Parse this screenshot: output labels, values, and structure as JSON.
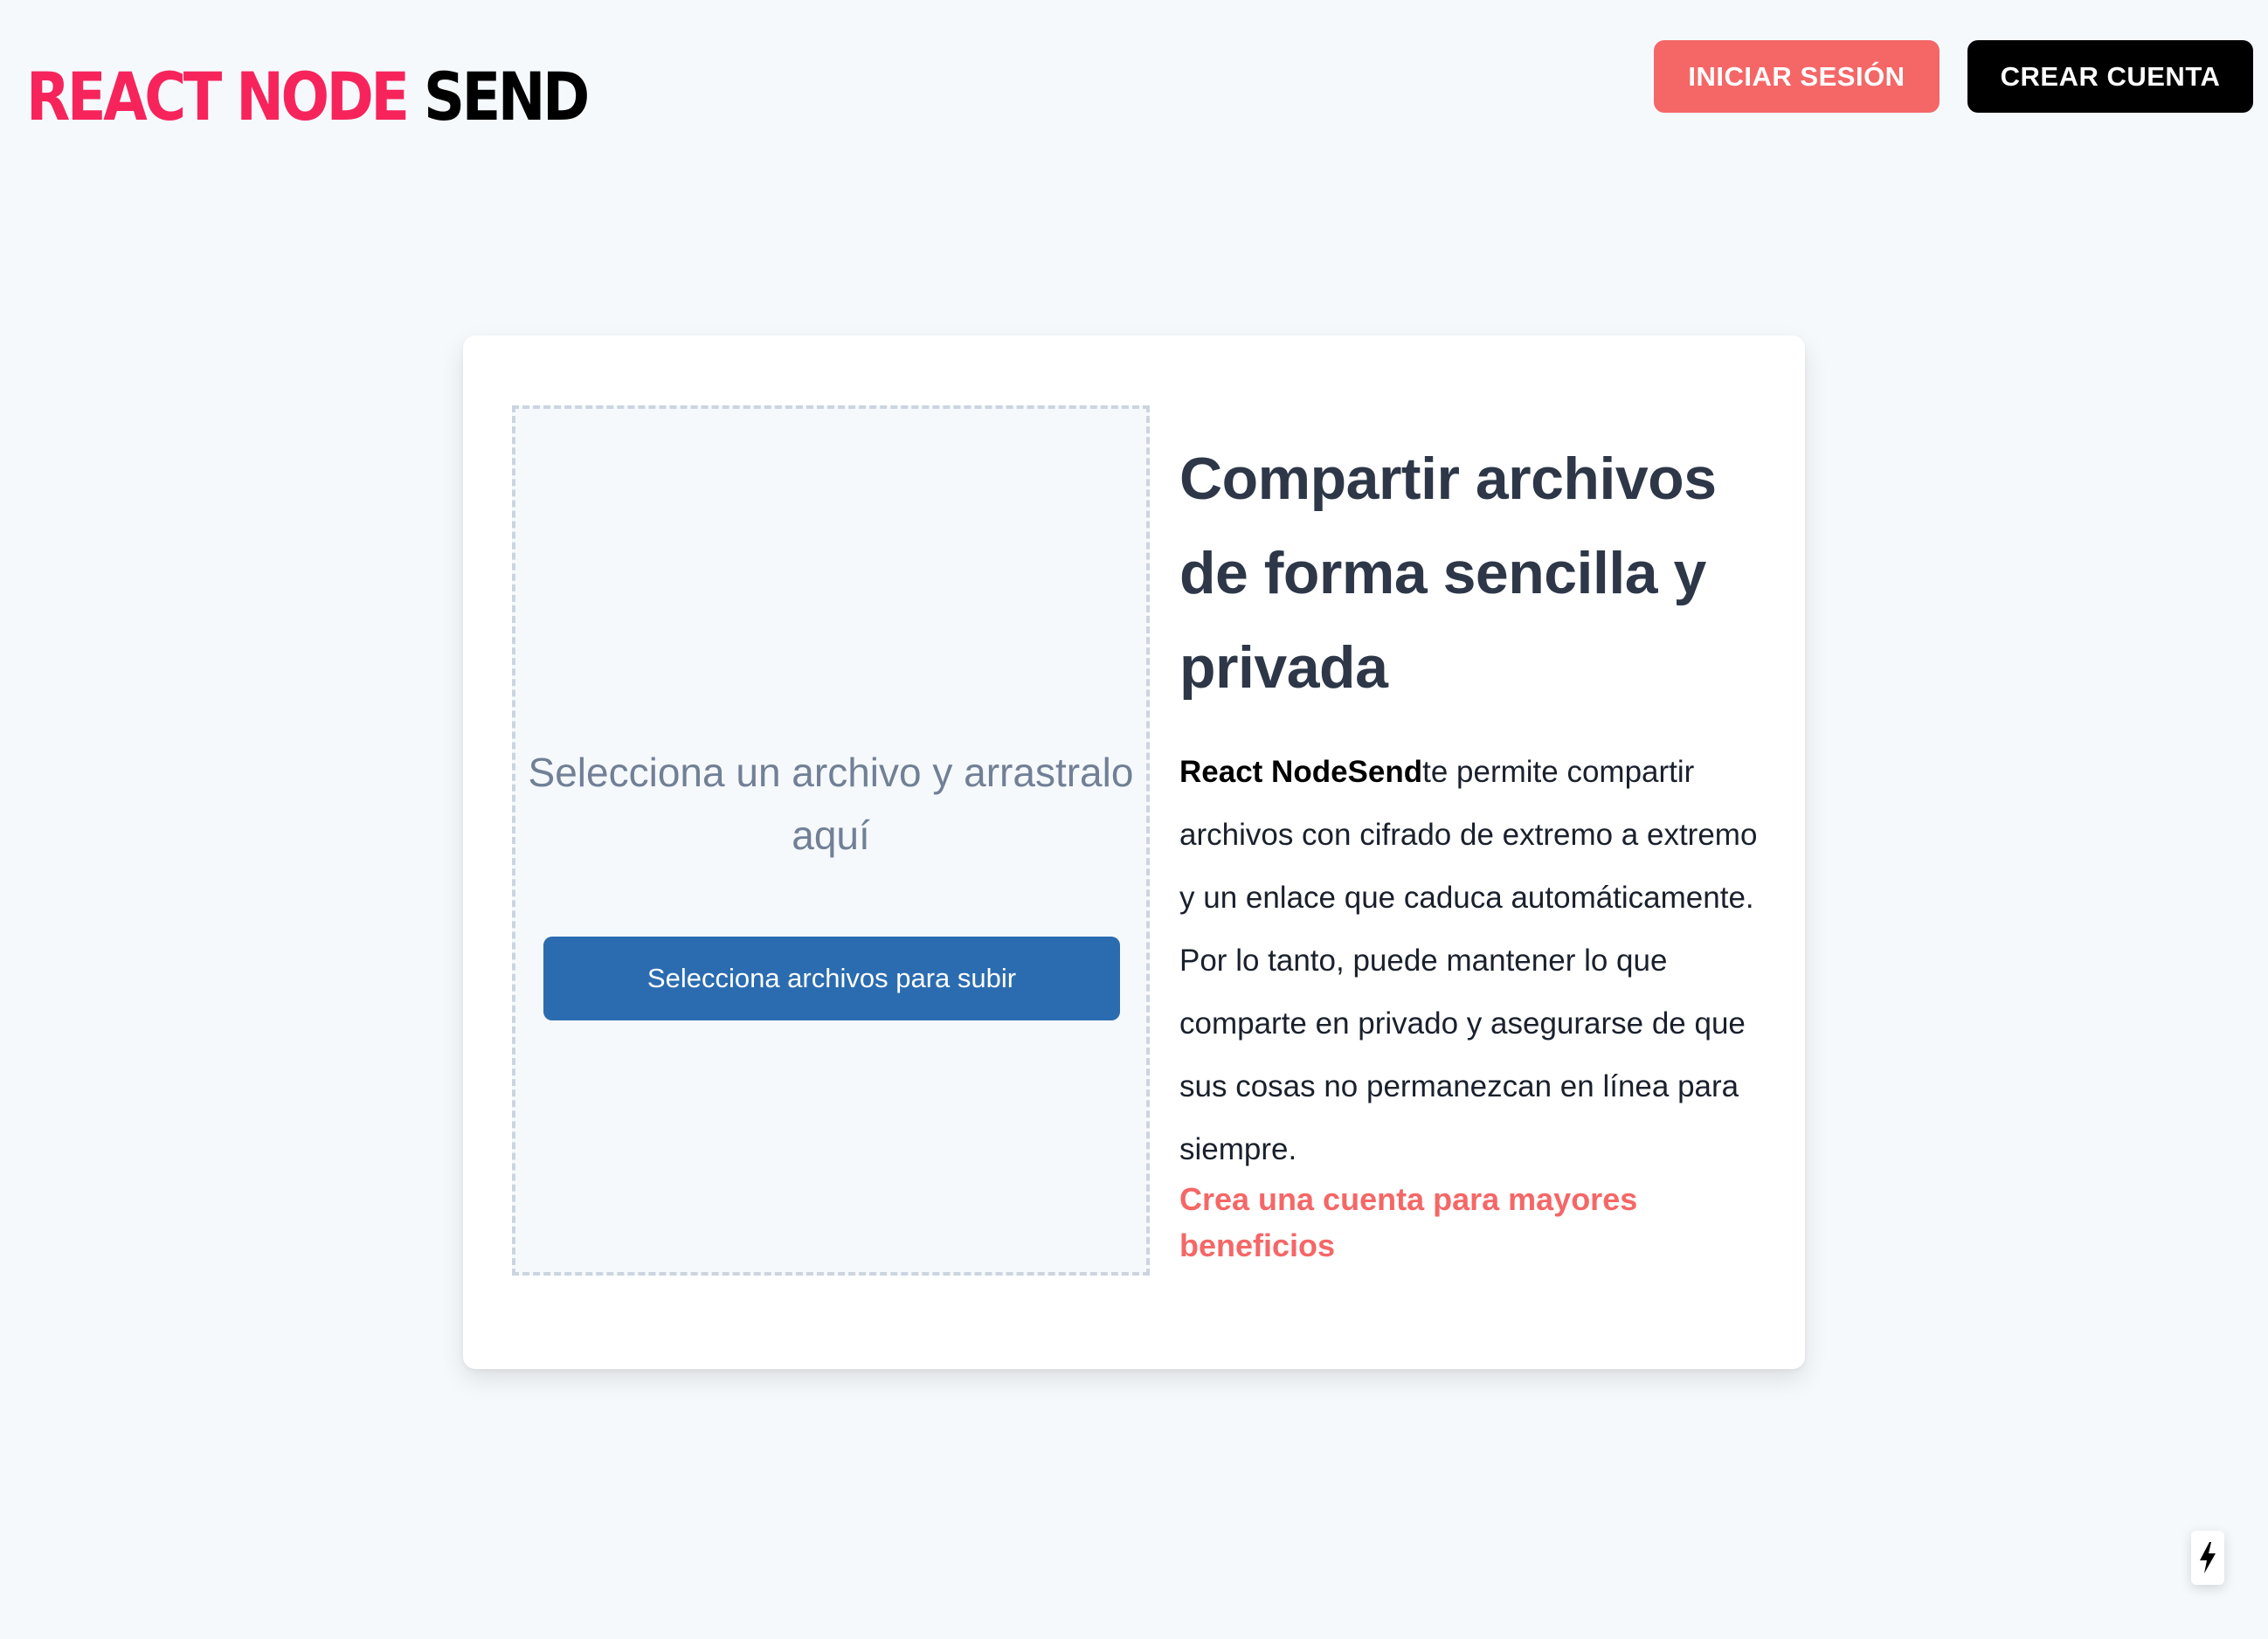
{
  "header": {
    "logo_part1": "REACT NODE",
    "logo_part2": "SEND",
    "login_label": "INICIAR SESIÓN",
    "signup_label": "CREAR CUENTA"
  },
  "dropzone": {
    "instruction": "Selecciona un archivo y arrastralo aquí",
    "button_label": "Selecciona archivos para subir"
  },
  "info": {
    "title": "Compartir archivos de forma sencilla y privada",
    "brand": "React NodeSend",
    "description": "te permite compartir archivos con cifrado de extremo a extremo y un enlace que caduca automáticamente. Por lo tanto, puede mantener lo que comparte en privado y asegurarse de que sus cosas no permanezcan en línea para siempre.",
    "cta": "Crea una cuenta para mayores beneficios"
  },
  "corner_badge": {
    "icon": "lightning-bolt-icon"
  },
  "colors": {
    "background": "#f6f9fc",
    "brand_red": "#f7245c",
    "login_button": "#f56767",
    "upload_button": "#2b6cb0",
    "heading": "#2d3748"
  }
}
